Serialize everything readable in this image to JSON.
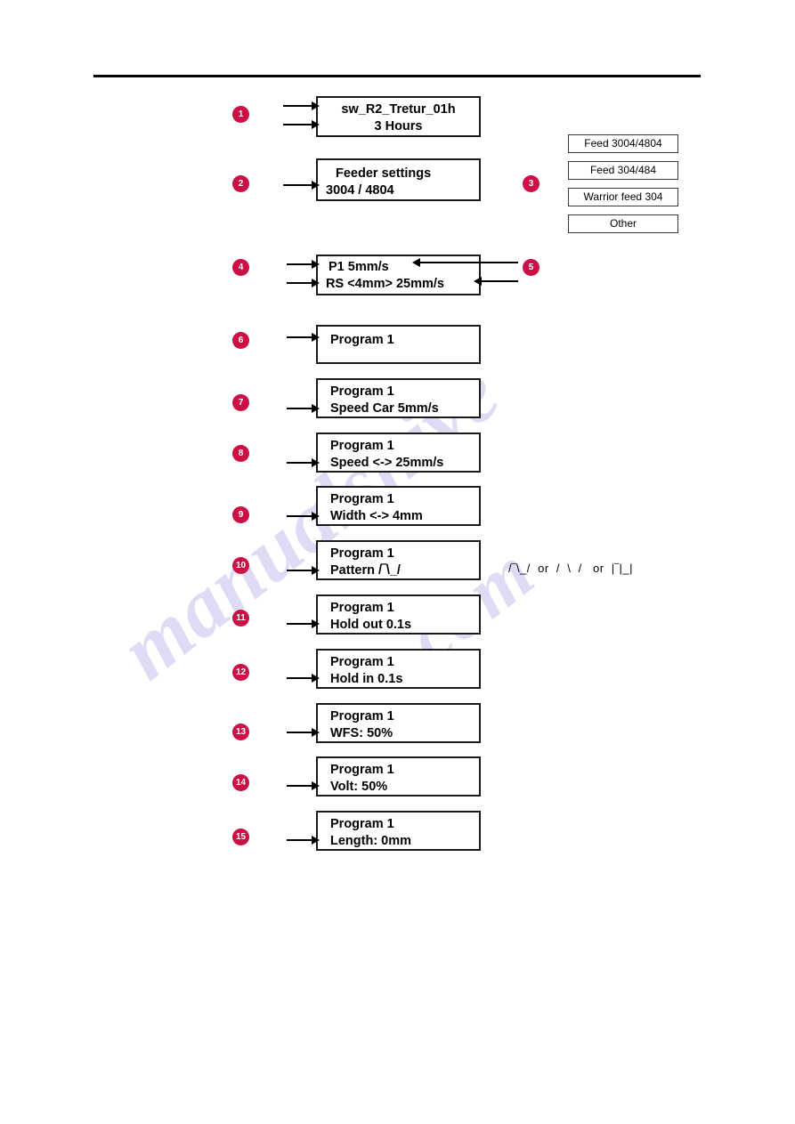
{
  "document": {
    "watermark_line1": "manualshive",
    "watermark_line2": ".com"
  },
  "markers": {
    "m1": "1",
    "m2": "2",
    "m3": "3",
    "m4": "4",
    "m5": "5",
    "m6": "6",
    "m7": "7",
    "m8": "8",
    "m9": "9",
    "m10": "10",
    "m11": "11",
    "m12": "12",
    "m13": "13",
    "m14": "14",
    "m15": "15"
  },
  "screens": {
    "startup": {
      "line1": "sw_R2_Tretur_01h",
      "line2": "3 Hours"
    },
    "feeder_settings": {
      "line1": "Feeder settings",
      "line2": "3004 / 4804"
    },
    "speed_overview": {
      "line1": "P1  5mm/s",
      "line2": "RS <4mm> 25mm/s"
    },
    "program_select": {
      "line1": "Program 1"
    },
    "speed_car": {
      "line1": "Program 1",
      "line2": "Speed Car 5mm/s"
    },
    "speed_weave": {
      "line1": "Program 1",
      "line2": "Speed <-> 25mm/s"
    },
    "width": {
      "line1": "Program 1",
      "line2": "Width <-> 4mm"
    },
    "pattern": {
      "line1": "Program 1",
      "line2": "Pattern  /‾\\_/"
    },
    "hold_out": {
      "line1": "Program 1",
      "line2": "Hold out  0.1s"
    },
    "hold_in": {
      "line1": "Program 1",
      "line2": "Hold in  0.1s"
    },
    "wfs": {
      "line1": "Program 1",
      "line2": "WFS:  50%"
    },
    "volt": {
      "line1": "Program 1",
      "line2": "Volt:  50%"
    },
    "length": {
      "line1": "Program 1",
      "line2": "Length:  0mm"
    }
  },
  "feeder_options": [
    {
      "label": "Feed 3004/4804"
    },
    {
      "label": "Feed 304/484"
    },
    {
      "label": "Warrior feed 304"
    },
    {
      "label": "Other"
    }
  ],
  "pattern_alternatives": {
    "text": "/‾\\_/  or  /  \\  /   or  |‾|_|"
  },
  "colors": {
    "marker": "#cc0f45",
    "box_border": "#1a1a1a",
    "watermark": "#c9c8ee"
  }
}
